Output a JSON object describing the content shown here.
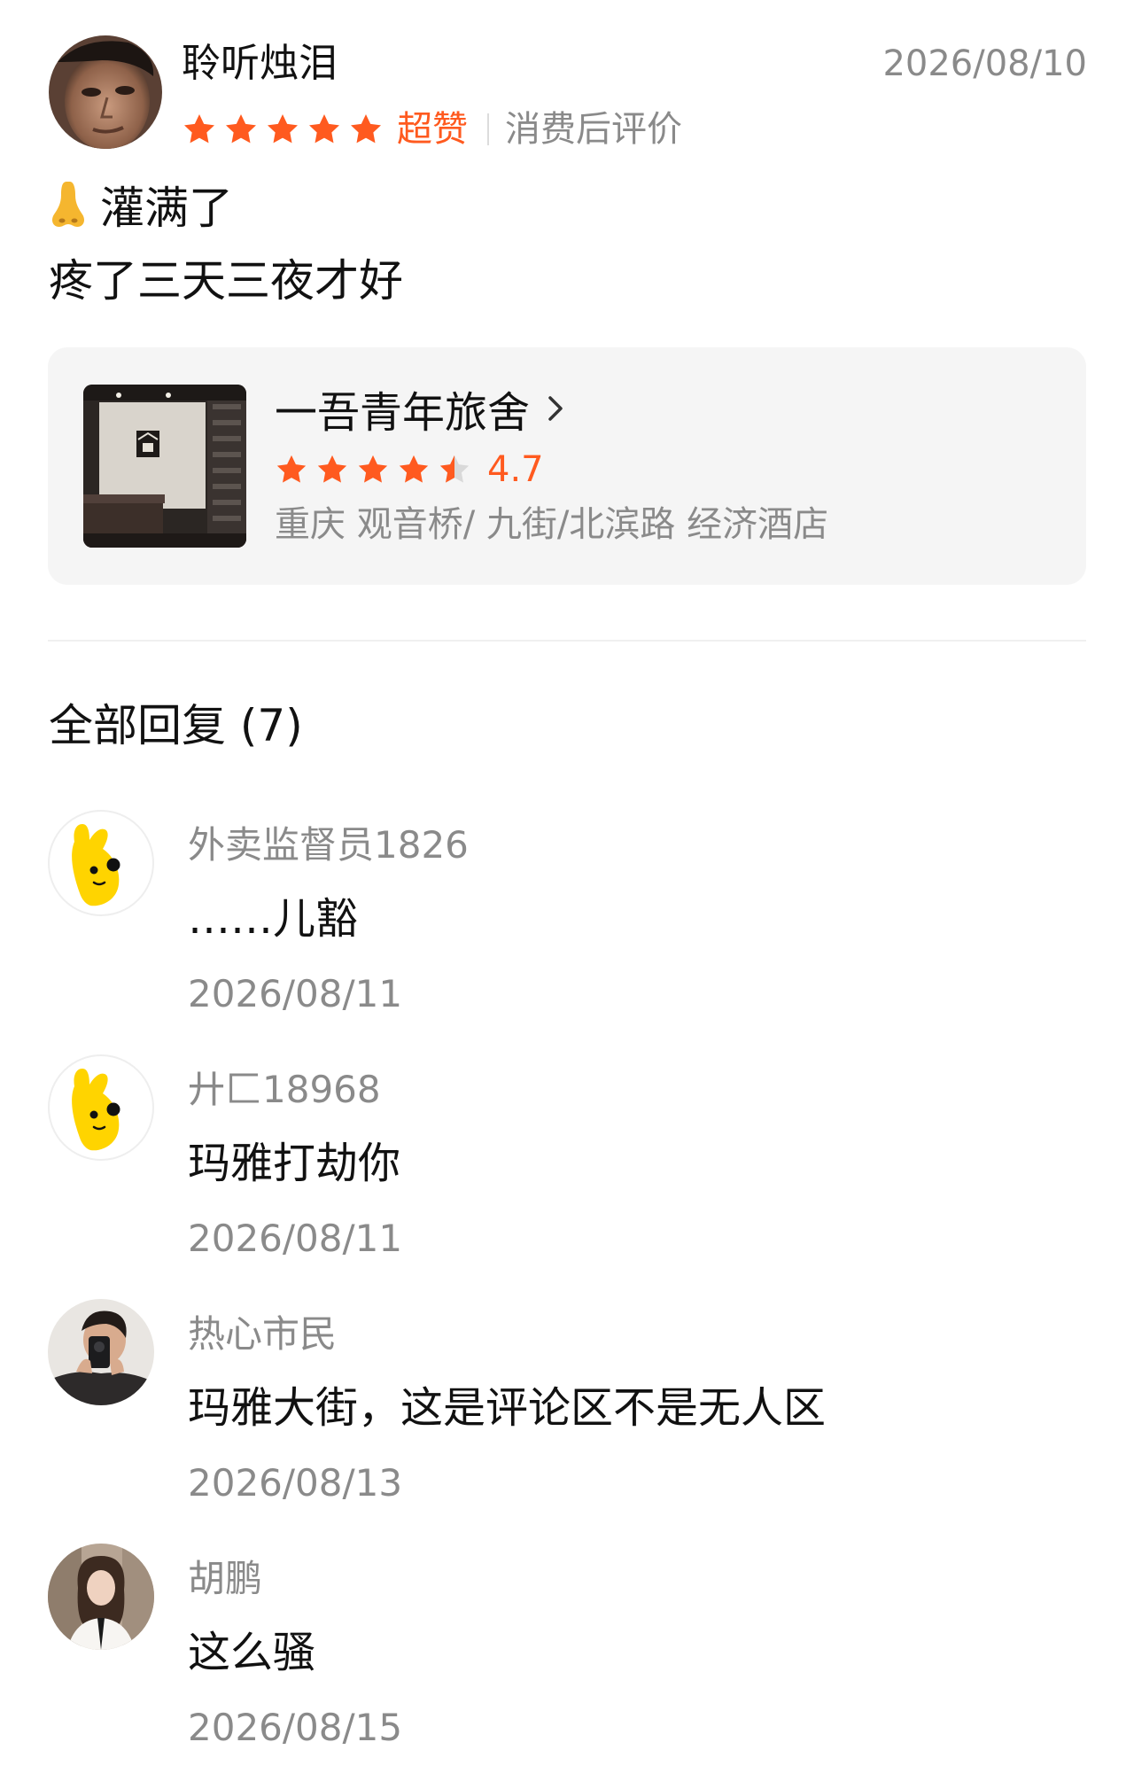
{
  "review": {
    "author": "聆听烛泪",
    "date": "2026/08/10",
    "stars": 5,
    "rating_word": "超赞",
    "rating_note": "消费后评价",
    "text_line1": "灌满了",
    "text_line2": "疼了三天三夜才好",
    "emoji_icon": "nose-icon"
  },
  "shop": {
    "name": "一吾青年旅舍",
    "rating": "4.7",
    "location": "重庆 观音桥/ 九街/北滨路 经济酒店"
  },
  "replies_heading": "全部回复 (7)",
  "replies": [
    {
      "name": "外卖监督员1826",
      "text": "……儿豁",
      "date": "2026/08/11"
    },
    {
      "name": "廾匚18968",
      "text": "玛雅打劫你",
      "date": "2026/08/11"
    },
    {
      "name": "热心市民",
      "text": "玛雅大街，这是评论区不是无人区",
      "date": "2026/08/13"
    },
    {
      "name": "胡鹏",
      "text": "这么骚",
      "date": "2026/08/15"
    }
  ],
  "colors": {
    "accent": "#ff5a1f",
    "muted_text": "#8a8a8a",
    "card_bg": "#f5f5f5",
    "star_empty": "#d9d9d9"
  }
}
